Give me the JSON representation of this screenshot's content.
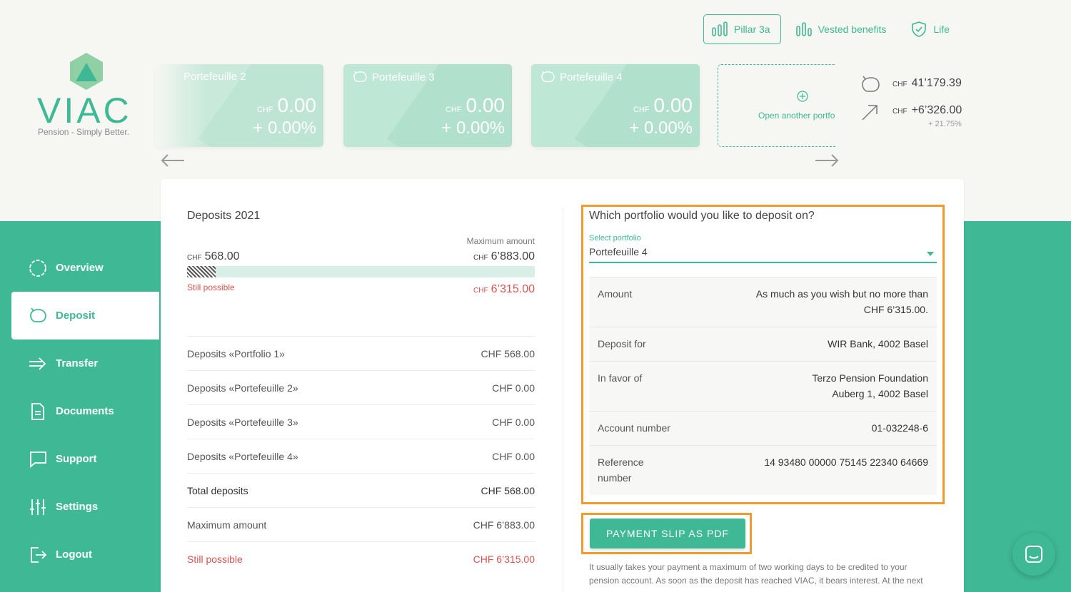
{
  "brand": {
    "name": "VIAC",
    "tagline": "Pension - Simply Better."
  },
  "colors": {
    "accent": "#3fb895",
    "warning": "#d9534f",
    "highlight": "#f29a2e"
  },
  "topnav": [
    {
      "label": "Pillar 3a",
      "icon": "bar-chart-icon",
      "active": true
    },
    {
      "label": "Vested benefits",
      "icon": "bar-chart-icon",
      "active": false
    },
    {
      "label": "Life",
      "icon": "shield-check-icon",
      "active": false
    }
  ],
  "cards": [
    {
      "name": "Portefeuille 2",
      "currency": "CHF",
      "amount": "0.00",
      "change": "+ 0.00%"
    },
    {
      "name": "Portefeuille 3",
      "currency": "CHF",
      "amount": "0.00",
      "change": "+ 0.00%"
    },
    {
      "name": "Portefeuille 4",
      "currency": "CHF",
      "amount": "0.00",
      "change": "+ 0.00%"
    }
  ],
  "new_card": {
    "label": "Open another portfolio"
  },
  "summary": {
    "total_currency": "CHF",
    "total": "41’179.39",
    "gain_currency": "CHF",
    "gain": "+6’326.00",
    "gain_pct": "+ 21.75%"
  },
  "sidebar": [
    {
      "label": "Overview",
      "icon": "circle-icon",
      "active": false
    },
    {
      "label": "Deposit",
      "icon": "piggy-bank-icon",
      "active": true
    },
    {
      "label": "Transfer",
      "icon": "arrow-right-icon",
      "active": false
    },
    {
      "label": "Documents",
      "icon": "document-icon",
      "active": false
    },
    {
      "label": "Support",
      "icon": "chat-bubble-icon",
      "active": false
    },
    {
      "label": "Settings",
      "icon": "sliders-icon",
      "active": false
    },
    {
      "label": "Logout",
      "icon": "logout-icon",
      "active": false
    }
  ],
  "deposits": {
    "title": "Deposits 2021",
    "max_label": "Maximum amount",
    "current_currency": "CHF",
    "current": "568.00",
    "max_currency": "CHF",
    "max": "6’883.00",
    "progress_fraction": 0.0825,
    "still_label": "Still possible",
    "still_currency": "CHF",
    "still": "6’315.00",
    "rows": [
      {
        "label": "Deposits «Portfolio 1»",
        "value": "CHF 568.00",
        "kind": "normal"
      },
      {
        "label": "Deposits «Portefeuille 2»",
        "value": "CHF 0.00",
        "kind": "normal"
      },
      {
        "label": "Deposits «Portefeuille 3»",
        "value": "CHF 0.00",
        "kind": "normal"
      },
      {
        "label": "Deposits «Portefeuille 4»",
        "value": "CHF 0.00",
        "kind": "normal"
      },
      {
        "label": "Total deposits",
        "value": "CHF 568.00",
        "kind": "total"
      },
      {
        "label": "Maximum amount",
        "value": "CHF 6’883.00",
        "kind": "normal"
      },
      {
        "label": "Still possible",
        "value": "CHF 6’315.00",
        "kind": "still"
      }
    ]
  },
  "deposit_form": {
    "question": "Which portfolio would you like to deposit on?",
    "select_label": "Select portfolio",
    "select_value": "Portefeuille 4",
    "info": [
      {
        "key": "Amount",
        "value": "As much as you wish but no more than CHF 6’315.00."
      },
      {
        "key": "Deposit for",
        "value": "WIR Bank, 4002 Basel"
      },
      {
        "key": "In favor of",
        "value": "Terzo Pension Foundation\nAuberg 1, 4002 Basel"
      },
      {
        "key": "Account number",
        "value": "01-032248-6"
      },
      {
        "key": "Reference number",
        "value": "14 93480 00000 75145 22340 64669"
      }
    ],
    "pdf_button": "PAYMENT SLIP AS PDF",
    "note": "It usually takes your payment a maximum of two working days to be credited to your pension account. As soon as the deposit has reached VIAC, it bears interest. At the next"
  }
}
